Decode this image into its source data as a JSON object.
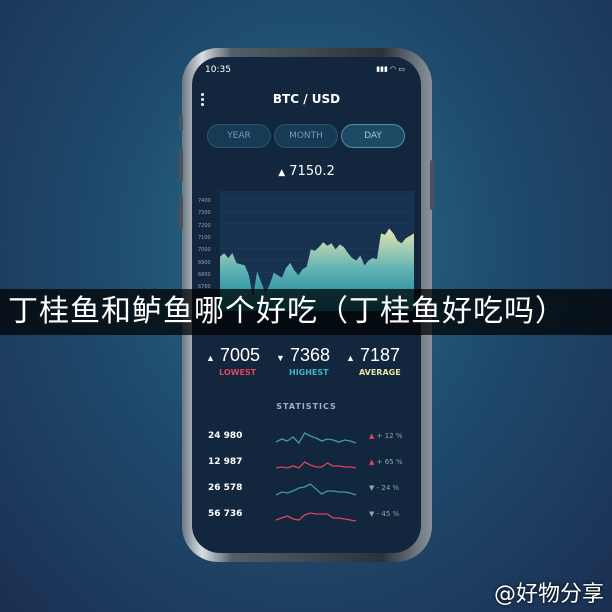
{
  "status": {
    "time": "10:35",
    "icons": "signal wifi battery"
  },
  "header": {
    "title": "BTC / USD",
    "menu_icon": "dots-vertical-icon"
  },
  "tabs": [
    {
      "label": "YEAR",
      "active": false
    },
    {
      "label": "MONTH",
      "active": false
    },
    {
      "label": "DAY",
      "active": true
    }
  ],
  "price": {
    "arrow": "▲",
    "value": "7150.2"
  },
  "chart": {
    "y_ticks": [
      "7400",
      "7300",
      "7200",
      "7100",
      "7000",
      "6900",
      "6800",
      "6700"
    ],
    "values": [
      6930,
      6960,
      6920,
      6960,
      6880,
      6870,
      6860,
      6780,
      6600,
      6810,
      6720,
      6640,
      6700,
      6800,
      6780,
      6760,
      6840,
      6880,
      6820,
      6780,
      6830,
      6850,
      6990,
      6980,
      7010,
      7050,
      7020,
      7040,
      6990,
      7030,
      7010,
      6960,
      6920,
      6900,
      6940,
      6860,
      6900,
      6920,
      6910,
      7120,
      7110,
      7160,
      7120,
      7060,
      7040,
      7080,
      7100,
      7120
    ]
  },
  "summary": [
    {
      "arrow": "▲",
      "value": "7005",
      "label": "LOWEST",
      "color": "#e0445a"
    },
    {
      "arrow": "▼",
      "value": "7368",
      "label": "HIGHEST",
      "color": "#3fb3c8"
    },
    {
      "arrow": "▲",
      "value": "7187",
      "label": "AVERAGE",
      "color": "#e8e4a8"
    }
  ],
  "statistics": {
    "title": "STATISTICS",
    "rows": [
      {
        "value": "24 980",
        "change": "+ 12 %",
        "arrow": "▲",
        "color": "#3d9bb0",
        "arrow_color": "#e0445a",
        "points": [
          3,
          6,
          4,
          8,
          2,
          12,
          9,
          7,
          4,
          6,
          5,
          3,
          5,
          4,
          2
        ]
      },
      {
        "value": "12 987",
        "change": "+ 65 %",
        "arrow": "▲",
        "color": "#e0445a",
        "arrow_color": "#e0445a",
        "points": [
          3,
          4,
          3,
          5,
          3,
          9,
          6,
          4,
          4,
          8,
          5,
          5,
          4,
          4,
          3
        ]
      },
      {
        "value": "26 578",
        "change": "- 24 %",
        "arrow": "▼",
        "color": "#3d9bb0",
        "arrow_color": "#8aa",
        "points": [
          2,
          5,
          4,
          6,
          9,
          10,
          13,
          8,
          3,
          6,
          6,
          5,
          5,
          4,
          2
        ]
      },
      {
        "value": "56 736",
        "change": "- 45 %",
        "arrow": "▼",
        "color": "#e0445a",
        "arrow_color": "#8aa",
        "points": [
          3,
          5,
          7,
          4,
          3,
          8,
          10,
          9,
          9,
          9,
          5,
          5,
          4,
          3,
          2
        ]
      }
    ]
  },
  "banner": "丁桂鱼和鲈鱼哪个好吃（丁桂鱼好吃吗）",
  "watermark": "@好物分享"
}
